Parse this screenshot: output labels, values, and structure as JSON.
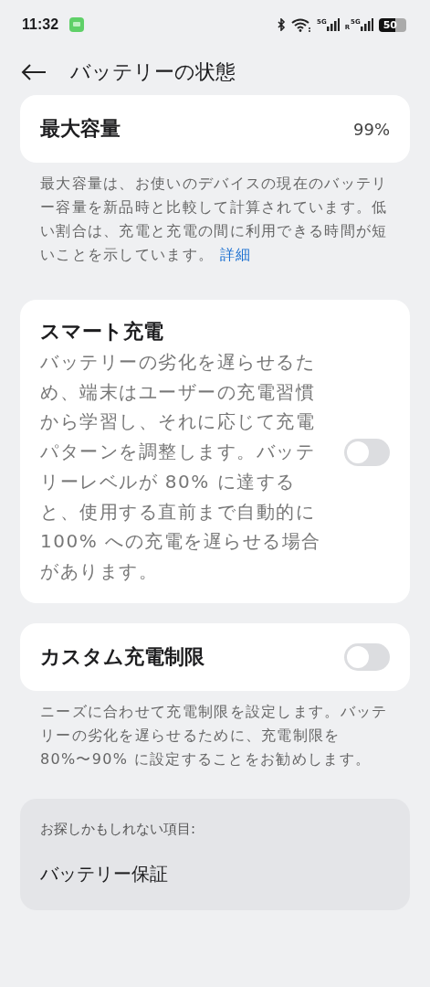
{
  "status_bar": {
    "time": "11:32",
    "network_1": "5G",
    "roaming": "R",
    "network_2": "5G",
    "battery": "50"
  },
  "header": {
    "title": "バッテリーの状態"
  },
  "max_capacity": {
    "label": "最大容量",
    "value": "99%",
    "note": "最大容量は、お使いのデバイスの現在のバッテリー容量を新品時と比較して計算されています。低い割合は、充電と充電の間に利用できる時間が短いことを示しています。",
    "link": "詳細"
  },
  "smart_charging": {
    "title": "スマート充電",
    "description": "バッテリーの劣化を遅らせるため、端末はユーザーの充電習慣から学習し、それに応じて充電パターンを調整します。バッテリーレベルが 80% に達すると、使用する直前まで自動的に 100% への充電を遅らせる場合があります。",
    "on": false
  },
  "custom_limit": {
    "title": "カスタム充電制限",
    "on": false,
    "note": "ニーズに合わせて充電制限を設定します。バッテリーの劣化を遅らせるために、充電制限を 80%〜90% に設定することをお勧めします。"
  },
  "suggestions": {
    "heading": "お探しかもしれない項目:",
    "items": [
      "バッテリー保証"
    ]
  }
}
